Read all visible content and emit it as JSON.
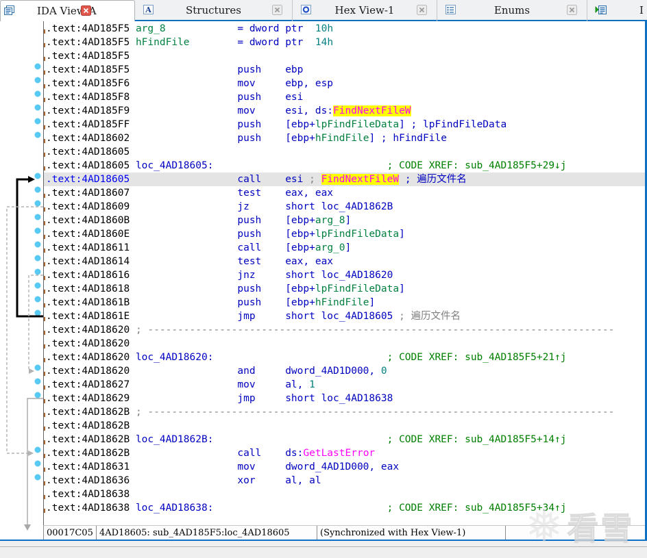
{
  "colors": {
    "accent_blue": "#0e70c4",
    "tab_bar_bg": "#eff1f3",
    "active_tab_bg": "#ffffff",
    "close_red": "#e2574c",
    "highlight_row_bg": "#e4e4e4",
    "ident_highlight_bg": "#ffff00",
    "addr": "#000000",
    "addr_current": "#0000f0",
    "code": "#0000c0",
    "name_green": "#008040",
    "xref_green": "#008000",
    "number_teal": "#008080",
    "import_magenta": "#ff00ff",
    "comment_gray": "#808080",
    "dot_blue": "#58c9f3",
    "status_text": "#000000"
  },
  "tab_bar": {
    "tabs": [
      {
        "title": "IDA View-A",
        "icon": "ida-view-icon",
        "active": true,
        "close": "red",
        "partial": false
      },
      {
        "title": "Structures",
        "icon": "structures-icon",
        "active": false,
        "close": "gray",
        "partial": false
      },
      {
        "title": "Hex View-1",
        "icon": "hex-view-icon",
        "active": false,
        "close": "gray",
        "partial": false
      },
      {
        "title": "Enums",
        "icon": "enums-icon",
        "active": false,
        "close": "gray",
        "partial": false
      },
      {
        "title": "I",
        "icon": "imports-icon",
        "active": false,
        "close": "none",
        "partial": true
      }
    ]
  },
  "listing": {
    "rows": [
      {
        "addr": ".text:4AD185F5",
        "segs": [
          [
            "g",
            "arg_8"
          ],
          [
            "n",
            "            = dword ptr  "
          ],
          [
            "t",
            "10h"
          ]
        ]
      },
      {
        "addr": ".text:4AD185F5",
        "segs": [
          [
            "g",
            "hFindFile"
          ],
          [
            "n",
            "        = dword ptr  "
          ],
          [
            "t",
            "14h"
          ]
        ]
      },
      {
        "addr": ".text:4AD185F5",
        "segs": []
      },
      {
        "addr": ".text:4AD185F5",
        "segs": [
          [
            "n",
            "                 push    ebp"
          ]
        ]
      },
      {
        "addr": ".text:4AD185F6",
        "segs": [
          [
            "n",
            "                 mov     ebp, esp"
          ]
        ]
      },
      {
        "addr": ".text:4AD185F8",
        "segs": [
          [
            "n",
            "                 push    esi"
          ]
        ]
      },
      {
        "addr": ".text:4AD185F9",
        "segs": [
          [
            "n",
            "                 mov     esi, ds:"
          ],
          [
            "hm",
            "FindNextFileW"
          ]
        ]
      },
      {
        "addr": ".text:4AD185FF",
        "segs": [
          [
            "n",
            "                 push    [ebp+"
          ],
          [
            "g",
            "lpFindFileData"
          ],
          [
            "n",
            "]"
          ],
          [
            "c",
            " ; lpFindFileData"
          ]
        ]
      },
      {
        "addr": ".text:4AD18602",
        "segs": [
          [
            "n",
            "                 push    [ebp+"
          ],
          [
            "g",
            "hFindFile"
          ],
          [
            "n",
            "]"
          ],
          [
            "c",
            " ; hFindFile"
          ]
        ]
      },
      {
        "addr": ".text:4AD18605",
        "segs": []
      },
      {
        "addr": ".text:4AD18605",
        "segs": [
          [
            "n",
            "loc_4AD18605:"
          ],
          [
            "x",
            "                             ; CODE XREF: sub_4AD185F5+29↓j"
          ]
        ]
      },
      {
        "addr": ".text:4AD18605",
        "cur": true,
        "segs": [
          [
            "n",
            "                 call    esi"
          ],
          [
            "gr",
            " ; "
          ],
          [
            "hm",
            "FindNextFileW"
          ],
          [
            "c",
            " ; 遍历文件名"
          ]
        ]
      },
      {
        "addr": ".text:4AD18607",
        "segs": [
          [
            "n",
            "                 test    eax, eax"
          ]
        ]
      },
      {
        "addr": ".text:4AD18609",
        "segs": [
          [
            "n",
            "                 jz      short loc_4AD1862B"
          ]
        ]
      },
      {
        "addr": ".text:4AD1860B",
        "segs": [
          [
            "n",
            "                 push    [ebp+"
          ],
          [
            "g",
            "arg_8"
          ],
          [
            "n",
            "]"
          ]
        ]
      },
      {
        "addr": ".text:4AD1860E",
        "segs": [
          [
            "n",
            "                 push    [ebp+"
          ],
          [
            "g",
            "lpFindFileData"
          ],
          [
            "n",
            "]"
          ]
        ]
      },
      {
        "addr": ".text:4AD18611",
        "segs": [
          [
            "n",
            "                 call    [ebp+"
          ],
          [
            "g",
            "arg_0"
          ],
          [
            "n",
            "]"
          ]
        ]
      },
      {
        "addr": ".text:4AD18614",
        "segs": [
          [
            "n",
            "                 test    eax, eax"
          ]
        ]
      },
      {
        "addr": ".text:4AD18616",
        "segs": [
          [
            "n",
            "                 jnz     short loc_4AD18620"
          ]
        ]
      },
      {
        "addr": ".text:4AD18618",
        "segs": [
          [
            "n",
            "                 push    [ebp+"
          ],
          [
            "g",
            "lpFindFileData"
          ],
          [
            "n",
            "]"
          ]
        ]
      },
      {
        "addr": ".text:4AD1861B",
        "segs": [
          [
            "n",
            "                 push    [ebp+"
          ],
          [
            "g",
            "hFindFile"
          ],
          [
            "n",
            "]"
          ]
        ]
      },
      {
        "addr": ".text:4AD1861E",
        "segs": [
          [
            "n",
            "                 jmp     short loc_4AD18605"
          ],
          [
            "gr",
            " ; 遍历文件名"
          ]
        ]
      },
      {
        "addr": ".text:4AD18620",
        "segs": [
          [
            "gr",
            "; ------------------------------------------------------------------------------"
          ]
        ]
      },
      {
        "addr": ".text:4AD18620",
        "segs": []
      },
      {
        "addr": ".text:4AD18620",
        "segs": [
          [
            "n",
            "loc_4AD18620:"
          ],
          [
            "x",
            "                             ; CODE XREF: sub_4AD185F5+21↑j"
          ]
        ]
      },
      {
        "addr": ".text:4AD18620",
        "segs": [
          [
            "n",
            "                 and     dword_4AD1D000, "
          ],
          [
            "t",
            "0"
          ]
        ]
      },
      {
        "addr": ".text:4AD18627",
        "segs": [
          [
            "n",
            "                 mov     al, "
          ],
          [
            "t",
            "1"
          ]
        ]
      },
      {
        "addr": ".text:4AD18629",
        "segs": [
          [
            "n",
            "                 jmp     short loc_4AD18638"
          ]
        ]
      },
      {
        "addr": ".text:4AD1862B",
        "segs": [
          [
            "gr",
            "; ------------------------------------------------------------------------------"
          ]
        ]
      },
      {
        "addr": ".text:4AD1862B",
        "segs": []
      },
      {
        "addr": ".text:4AD1862B",
        "segs": [
          [
            "n",
            "loc_4AD1862B:"
          ],
          [
            "x",
            "                             ; CODE XREF: sub_4AD185F5+14↑j"
          ]
        ]
      },
      {
        "addr": ".text:4AD1862B",
        "segs": [
          [
            "n",
            "                 call    ds:"
          ],
          [
            "m",
            "GetLastError"
          ]
        ]
      },
      {
        "addr": ".text:4AD18631",
        "segs": [
          [
            "n",
            "                 mov     dword_4AD1D000, eax"
          ]
        ]
      },
      {
        "addr": ".text:4AD18636",
        "segs": [
          [
            "n",
            "                 xor     al, al"
          ]
        ]
      },
      {
        "addr": ".text:4AD18638",
        "segs": []
      },
      {
        "addr": ".text:4AD18638",
        "segs": [
          [
            "n",
            "loc_4AD18638:"
          ],
          [
            "x",
            "                             ; CODE XREF: sub_4AD185F5+34↑j"
          ]
        ]
      }
    ]
  },
  "gutter": {
    "dot_rows": [
      4,
      5,
      6,
      7,
      8,
      9,
      12,
      13,
      14,
      15,
      16,
      17,
      18,
      19,
      20,
      21,
      22,
      26,
      27,
      28,
      32,
      33,
      34
    ],
    "arrows": [
      {
        "name": "jump-4AD1861E-to-4AD18605",
        "style": "bold",
        "x": 25,
        "from_row": 22,
        "to_row": 12,
        "head": "right"
      },
      {
        "name": "jump-4AD18609-to-4AD1862B",
        "style": "dashed",
        "x": 10,
        "from_row": 14,
        "to_row": 32,
        "head": "right"
      },
      {
        "name": "jump-4AD18616-to-4AD18620",
        "style": "dashed",
        "x": 42,
        "from_row": 19,
        "to_row": 26,
        "head": "right"
      },
      {
        "name": "jump-4AD18629-to-4AD18638",
        "style": "solid",
        "x": 40,
        "from_row": 28,
        "to_row": 37,
        "head": "down"
      }
    ]
  },
  "status_bar": {
    "cells": [
      "00017C05",
      "4AD18605: sub_4AD185F5:loc_4AD18605",
      "(Synchronized with Hex View-1)"
    ]
  },
  "watermark": {
    "flake": "❅",
    "brand": "看雪"
  }
}
